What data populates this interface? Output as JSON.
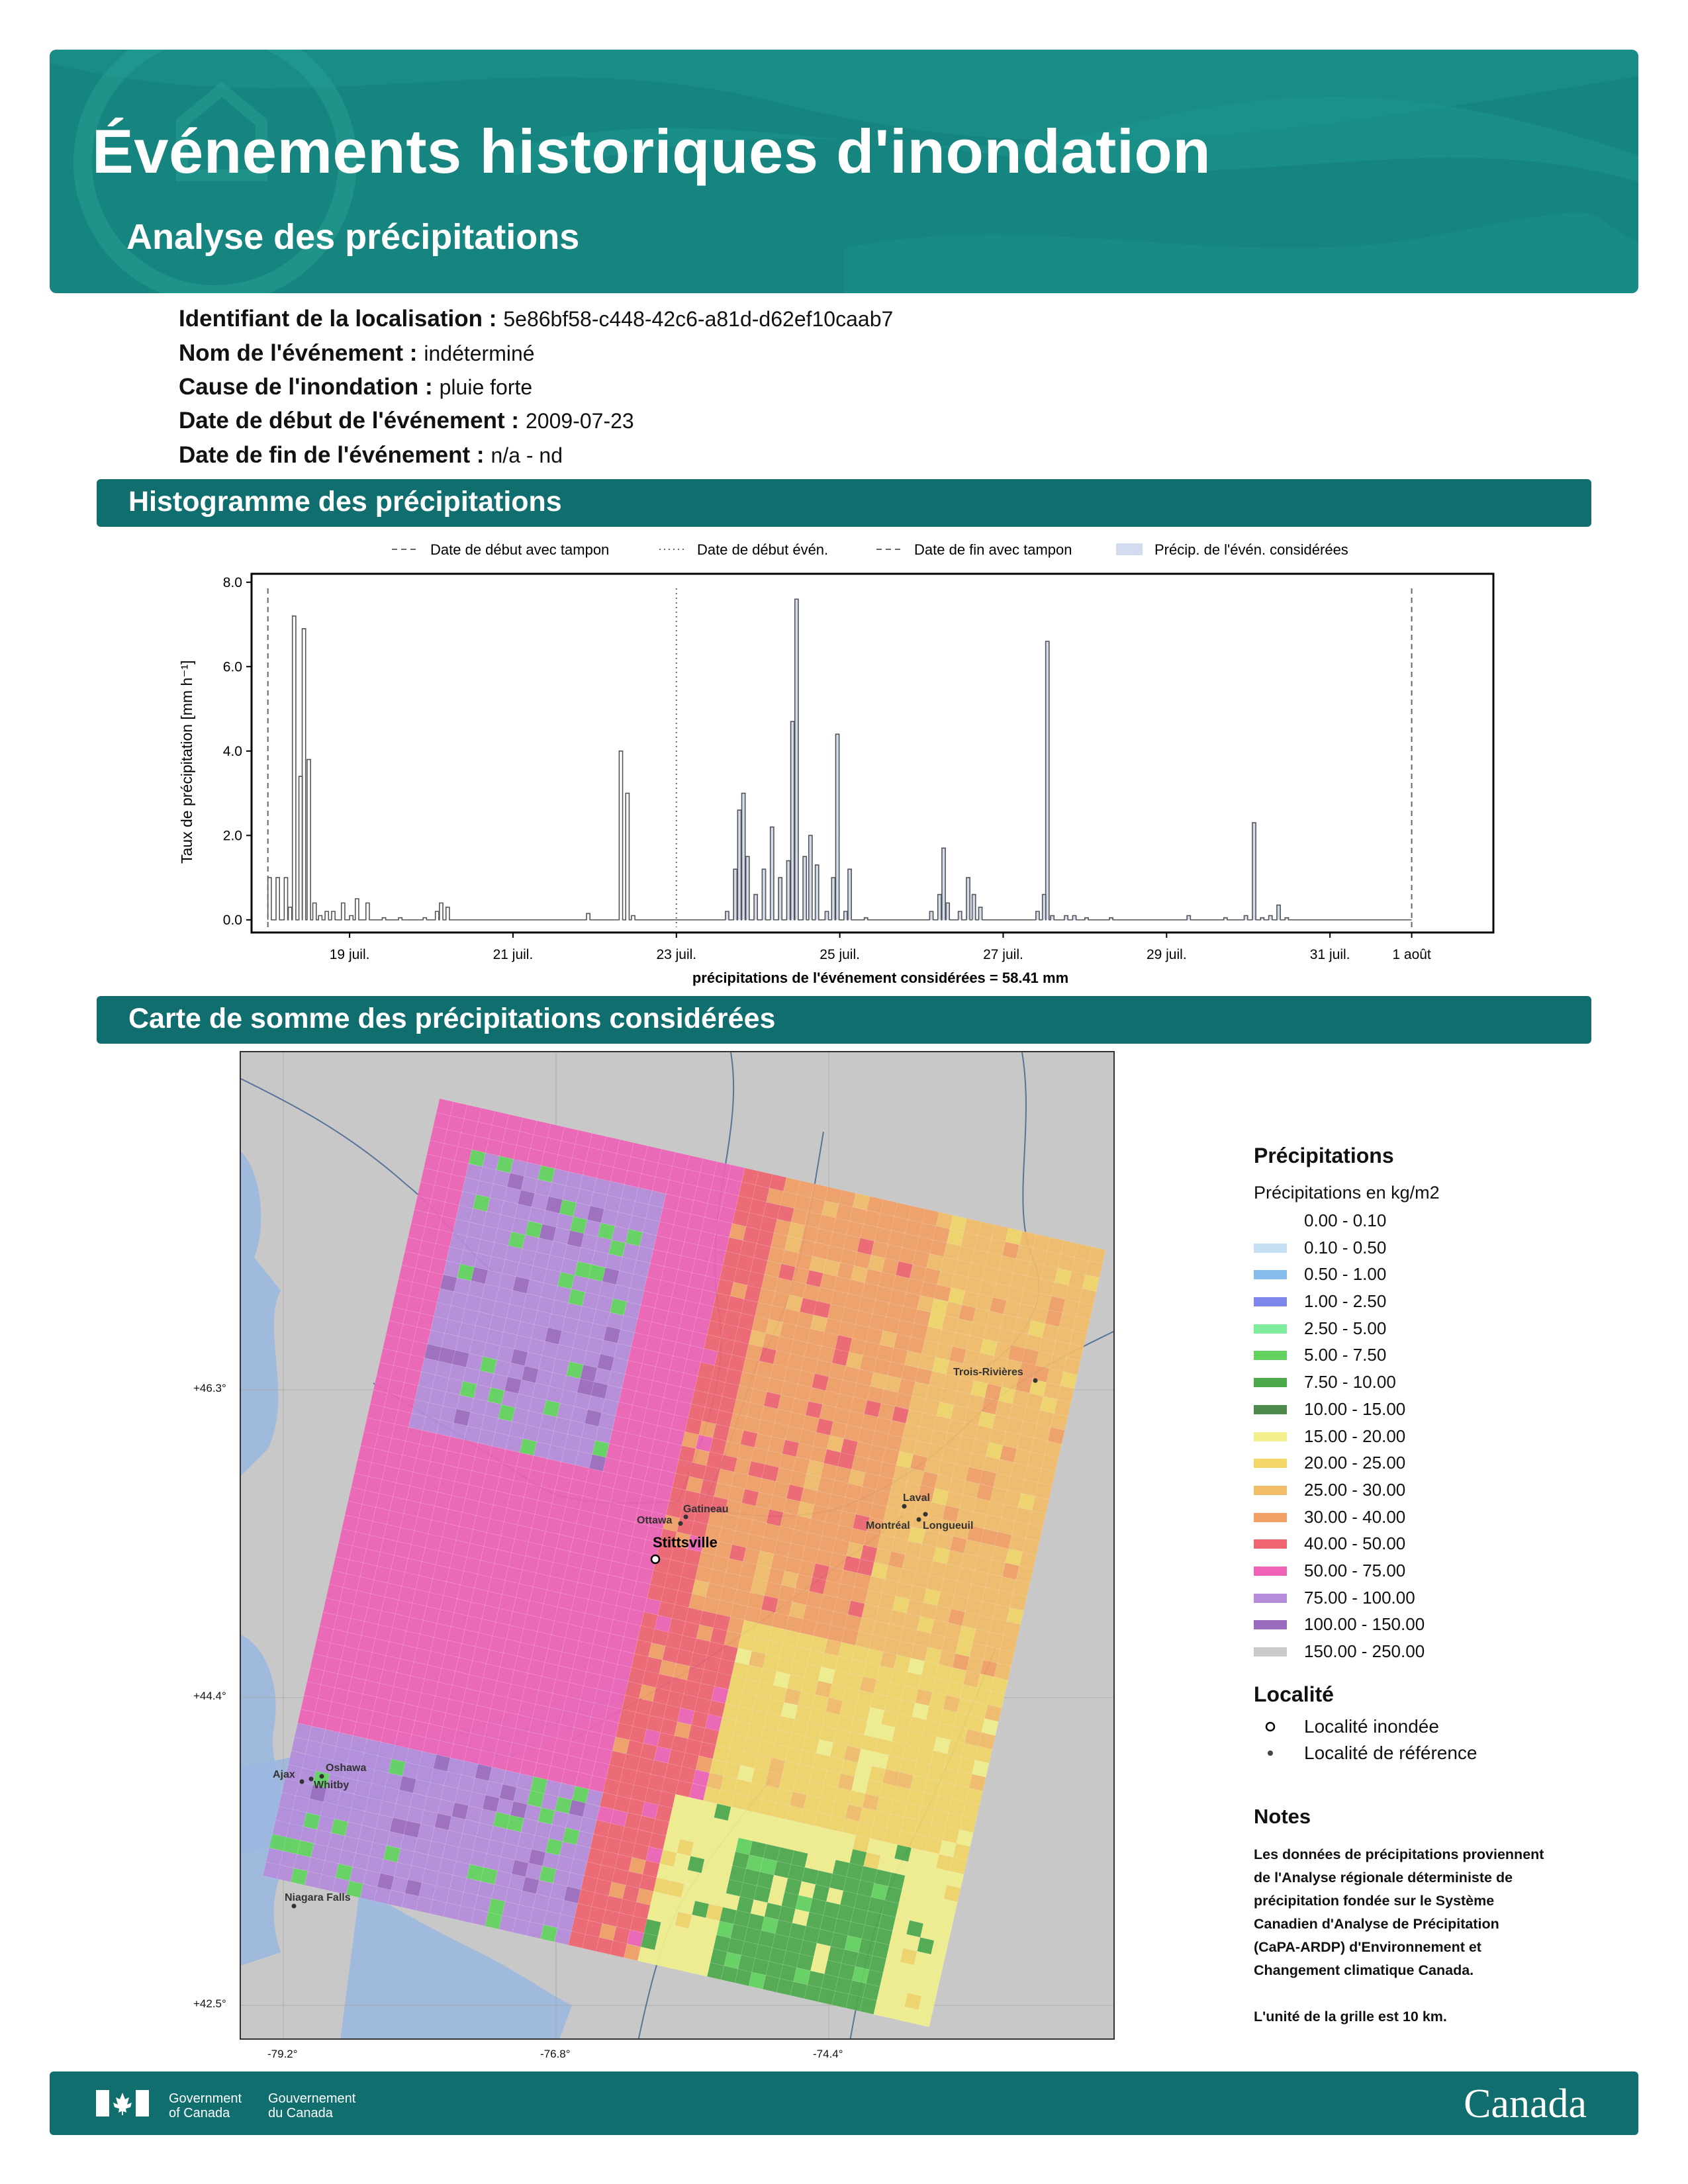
{
  "header": {
    "title": "Événements historiques d'inondation",
    "subtitle": "Analyse des précipitations"
  },
  "info": [
    {
      "label": "Identifiant de la localisation :",
      "value": "5e86bf58-c448-42c6-a81d-d62ef10caab7"
    },
    {
      "label": "Nom de l'événement :",
      "value": "indéterminé"
    },
    {
      "label": "Cause de l'inondation :",
      "value": "pluie forte"
    },
    {
      "label": "Date de début de l'événement :",
      "value": "2009-07-23"
    },
    {
      "label": "Date de fin de l'événement :",
      "value": "n/a - nd"
    }
  ],
  "sections": {
    "histogram": "Histogramme des précipitations",
    "map": "Carte de somme des précipitations considérées"
  },
  "chart_data": {
    "type": "line",
    "ylabel": "Taux de précipitation [mm h⁻¹]",
    "xlabel": "précipitations de l'événement considérées = 58.41 mm",
    "ylim": [
      -0.3,
      8.2
    ],
    "yticks": [
      "0.0",
      "2.0",
      "4.0",
      "6.0",
      "8.0"
    ],
    "xticks": [
      {
        "label": "19 juil.",
        "day": 19
      },
      {
        "label": "21 juil.",
        "day": 21
      },
      {
        "label": "23 juil.",
        "day": 23
      },
      {
        "label": "25 juil.",
        "day": 25
      },
      {
        "label": "27 juil.",
        "day": 27
      },
      {
        "label": "29 juil.",
        "day": 29
      },
      {
        "label": "31 juil.",
        "day": 31
      },
      {
        "label": "1 août",
        "day": 32
      }
    ],
    "xlim": [
      17.8,
      33.0
    ],
    "legend": [
      {
        "name": "Date de début avec tampon",
        "style": "dashed"
      },
      {
        "name": "Date de début évén.",
        "style": "dotted"
      },
      {
        "name": "Date de fin avec tampon",
        "style": "dashed"
      },
      {
        "name": "Précip. de l'évén. considérées",
        "style": "fill"
      }
    ],
    "buffer_start_day": 18.0,
    "event_start_day": 23.0,
    "buffer_end_day": 32.0,
    "considered_total": "58.41 mm",
    "bars": [
      [
        18.0,
        1.0,
        0
      ],
      [
        18.1,
        1.0,
        0
      ],
      [
        18.2,
        1.0,
        0
      ],
      [
        18.25,
        0.3,
        0
      ],
      [
        18.3,
        7.2,
        0
      ],
      [
        18.38,
        3.4,
        0
      ],
      [
        18.42,
        6.9,
        0
      ],
      [
        18.48,
        3.8,
        0
      ],
      [
        18.55,
        0.4,
        0
      ],
      [
        18.62,
        0.1,
        0
      ],
      [
        18.7,
        0.2,
        0
      ],
      [
        18.78,
        0.2,
        0
      ],
      [
        18.9,
        0.4,
        0
      ],
      [
        19.0,
        0.1,
        0
      ],
      [
        19.07,
        0.5,
        0
      ],
      [
        19.2,
        0.4,
        0
      ],
      [
        19.4,
        0.05,
        0
      ],
      [
        19.6,
        0.05,
        0
      ],
      [
        19.9,
        0.05,
        0
      ],
      [
        20.05,
        0.2,
        0
      ],
      [
        20.1,
        0.4,
        0
      ],
      [
        20.18,
        0.3,
        0
      ],
      [
        21.9,
        0.15,
        0
      ],
      [
        22.3,
        4.0,
        0
      ],
      [
        22.38,
        3.0,
        0
      ],
      [
        22.45,
        0.1,
        0
      ],
      [
        23.6,
        0.2,
        1
      ],
      [
        23.7,
        1.2,
        1
      ],
      [
        23.75,
        2.6,
        1
      ],
      [
        23.8,
        3.0,
        1
      ],
      [
        23.85,
        1.5,
        1
      ],
      [
        23.95,
        0.6,
        1
      ],
      [
        24.05,
        1.2,
        1
      ],
      [
        24.15,
        2.2,
        1
      ],
      [
        24.25,
        1.0,
        1
      ],
      [
        24.35,
        1.4,
        1
      ],
      [
        24.4,
        4.7,
        1
      ],
      [
        24.45,
        7.6,
        1
      ],
      [
        24.55,
        1.5,
        1
      ],
      [
        24.62,
        2.0,
        1
      ],
      [
        24.7,
        1.3,
        1
      ],
      [
        24.82,
        0.2,
        1
      ],
      [
        24.9,
        1.0,
        1
      ],
      [
        24.95,
        4.4,
        1
      ],
      [
        25.05,
        0.2,
        1
      ],
      [
        25.1,
        1.2,
        1
      ],
      [
        25.3,
        0.05,
        1
      ],
      [
        26.1,
        0.2,
        1
      ],
      [
        26.2,
        0.6,
        1
      ],
      [
        26.25,
        1.7,
        1
      ],
      [
        26.3,
        0.4,
        1
      ],
      [
        26.45,
        0.2,
        1
      ],
      [
        26.55,
        1.0,
        1
      ],
      [
        26.62,
        0.6,
        1
      ],
      [
        26.7,
        0.3,
        1
      ],
      [
        27.4,
        0.2,
        1
      ],
      [
        27.48,
        0.6,
        1
      ],
      [
        27.52,
        6.6,
        1
      ],
      [
        27.58,
        0.1,
        1
      ],
      [
        27.75,
        0.1,
        1
      ],
      [
        27.85,
        0.1,
        1
      ],
      [
        28.0,
        0.05,
        1
      ],
      [
        28.3,
        0.05,
        1
      ],
      [
        29.25,
        0.1,
        1
      ],
      [
        29.7,
        0.05,
        1
      ],
      [
        29.95,
        0.1,
        1
      ],
      [
        30.05,
        2.3,
        1
      ],
      [
        30.15,
        0.05,
        1
      ],
      [
        30.25,
        0.1,
        1
      ],
      [
        30.35,
        0.35,
        1
      ],
      [
        30.45,
        0.05,
        1
      ]
    ]
  },
  "map": {
    "lat_labels": [
      "+46.3°",
      "+44.4°",
      "+42.5°"
    ],
    "lon_labels": [
      "-79.2°",
      "-76.8°",
      "-74.4°"
    ],
    "places": {
      "flooded": "Stittsville",
      "references": [
        "Trois-Rivières",
        "Gatineau",
        "Ottawa",
        "Laval",
        "Montréal",
        "Longueuil",
        "Oshawa",
        "Ajax",
        "Whitby",
        "Niagara Falls"
      ]
    }
  },
  "legend": {
    "title": "Précipitations",
    "subtitle": "Précipitations en kg/m2",
    "items": [
      {
        "label": "0.00 - 0.10",
        "color": "#ffffff"
      },
      {
        "label": "0.10 - 0.50",
        "color": "#c5dff3"
      },
      {
        "label": "0.50 - 1.00",
        "color": "#86bdec"
      },
      {
        "label": "1.00 - 2.50",
        "color": "#7f86ea"
      },
      {
        "label": "2.50 - 5.00",
        "color": "#7ded9d"
      },
      {
        "label": "5.00 - 7.50",
        "color": "#62d35f"
      },
      {
        "label": "7.50 - 10.00",
        "color": "#4daa4c"
      },
      {
        "label": "10.00 - 15.00",
        "color": "#4d8a4c"
      },
      {
        "label": "15.00 - 20.00",
        "color": "#f2f08c"
      },
      {
        "label": "20.00 - 25.00",
        "color": "#f2d668"
      },
      {
        "label": "25.00 - 30.00",
        "color": "#f2bd68"
      },
      {
        "label": "30.00 - 40.00",
        "color": "#f2a066"
      },
      {
        "label": "40.00 - 50.00",
        "color": "#ee6470"
      },
      {
        "label": "50.00 - 75.00",
        "color": "#ef63b6"
      },
      {
        "label": "75.00 - 100.00",
        "color": "#b58ddb"
      },
      {
        "label": "100.00 - 150.00",
        "color": "#9b6bbf"
      },
      {
        "label": "150.00 - 250.00",
        "color": "#c9c9c9"
      }
    ],
    "locality_title": "Localité",
    "locality_items": [
      {
        "label": "Localité inondée",
        "symbol": "open-circle"
      },
      {
        "label": "Localité de référence",
        "symbol": "dot"
      }
    ],
    "notes_title": "Notes",
    "notes_lines": [
      "Les données de précipitations proviennent",
      "de l'Analyse régionale déterministe de",
      "précipitation fondée sur le Système",
      "Canadien d'Analyse de Précipitation",
      "(CaPA-ARDP) d'Environnement et",
      "Changement climatique Canada.",
      "",
      "L'unité de la grille est 10 km."
    ]
  },
  "footer": {
    "gov_en_1": "Government",
    "gov_en_2": "of Canada",
    "gov_fr_1": "Gouvernement",
    "gov_fr_2": "du Canada",
    "wordmark": "Canada"
  }
}
